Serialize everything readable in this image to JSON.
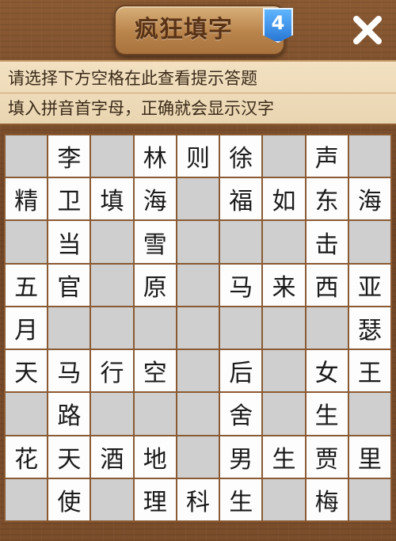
{
  "header": {
    "title": "疯狂填字",
    "level": "4"
  },
  "hints": {
    "line1": "请选择下方空格在此查看提示答题",
    "line2": "填入拼音首字母，正确就会显示汉字"
  },
  "grid": [
    [
      "",
      "李",
      "",
      "林",
      "则",
      "徐",
      "",
      "声",
      ""
    ],
    [
      "精",
      "卫",
      "填",
      "海",
      "",
      "福",
      "如",
      "东",
      "海"
    ],
    [
      "",
      "当",
      "",
      "雪",
      "",
      "",
      "",
      "击",
      ""
    ],
    [
      "五",
      "官",
      "",
      "原",
      "",
      "马",
      "来",
      "西",
      "亚"
    ],
    [
      "月",
      "",
      "",
      "",
      "",
      "",
      "",
      "",
      "瑟"
    ],
    [
      "天",
      "马",
      "行",
      "空",
      "",
      "后",
      "",
      "女",
      "王"
    ],
    [
      "",
      "路",
      "",
      "",
      "",
      "舍",
      "",
      "生",
      ""
    ],
    [
      "花",
      "天",
      "酒",
      "地",
      "",
      "男",
      "生",
      "贾",
      "里"
    ],
    [
      "",
      "使",
      "",
      "理",
      "科",
      "生",
      "",
      "梅",
      ""
    ]
  ],
  "colors": {
    "wood": "#7a4d2b",
    "cell_filled": "#fdfdfd",
    "cell_blank": "#cfcfcf",
    "hint_bg": "#f2e1c2",
    "badge": "#2a78d6"
  },
  "icons": {
    "close": "close-icon",
    "level_badge": "level-badge-icon"
  }
}
